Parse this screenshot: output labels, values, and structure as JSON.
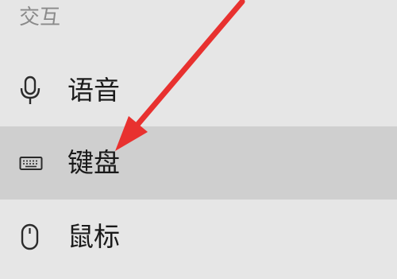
{
  "sidebar": {
    "section_header": "交互",
    "items": [
      {
        "label": "语音",
        "icon": "microphone-icon",
        "selected": false
      },
      {
        "label": "键盘",
        "icon": "keyboard-icon",
        "selected": true
      },
      {
        "label": "鼠标",
        "icon": "mouse-icon",
        "selected": false
      }
    ]
  },
  "colors": {
    "background": "#e6e6e6",
    "selected_background": "#cfcfcf",
    "header_text": "#8a8a8a",
    "annotation_arrow": "#e8312f"
  }
}
